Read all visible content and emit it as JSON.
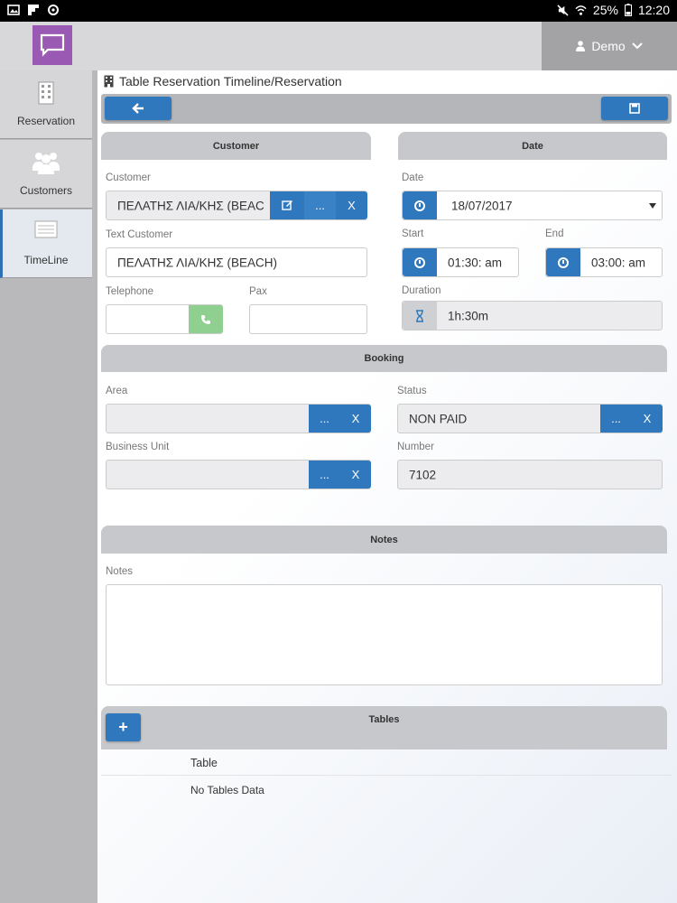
{
  "status_bar": {
    "battery": "25%",
    "time": "12:20"
  },
  "header": {
    "user_name": "Demo"
  },
  "sidebar": {
    "items": [
      {
        "label": "Reservation",
        "icon": "building-icon"
      },
      {
        "label": "Customers",
        "icon": "users-icon"
      },
      {
        "label": "TimeLine",
        "icon": "list-icon"
      }
    ]
  },
  "page": {
    "title": "Table Reservation Timeline/Reservation"
  },
  "customer_section": {
    "header": "Customer",
    "customer_label": "Customer",
    "customer_value": "ΠΕΛΑΤΗΣ ΛΙΑ/ΚΗΣ (BEAC",
    "more_label": "...",
    "clear_label": "X",
    "text_customer_label": "Text Customer",
    "text_customer_value": "ΠΕΛΑΤΗΣ ΛΙΑ/ΚΗΣ (BEACH)",
    "telephone_label": "Telephone",
    "telephone_value": "",
    "pax_label": "Pax",
    "pax_value": ""
  },
  "date_section": {
    "header": "Date",
    "date_label": "Date",
    "date_value": "18/07/2017",
    "start_label": "Start",
    "start_value": "01:30: am",
    "end_label": "End",
    "end_value": "03:00: am",
    "duration_label": "Duration",
    "duration_value": "1h:30m"
  },
  "booking_section": {
    "header": "Booking",
    "area_label": "Area",
    "area_value": "",
    "status_label": "Status",
    "status_value": "NON PAID",
    "business_unit_label": "Business Unit",
    "business_unit_value": "",
    "number_label": "Number",
    "number_value": "7102",
    "more_label": "...",
    "clear_label": "X"
  },
  "notes_section": {
    "header": "Notes",
    "notes_label": "Notes",
    "notes_value": ""
  },
  "tables_section": {
    "header": "Tables",
    "add_label": "+",
    "column_header": "Table",
    "empty_text": "No Tables Data"
  },
  "colors": {
    "primary": "#2f78bd",
    "logo": "#9a5ab3",
    "call_button": "#8fcf8f",
    "section_header": "#c7c8cb"
  }
}
